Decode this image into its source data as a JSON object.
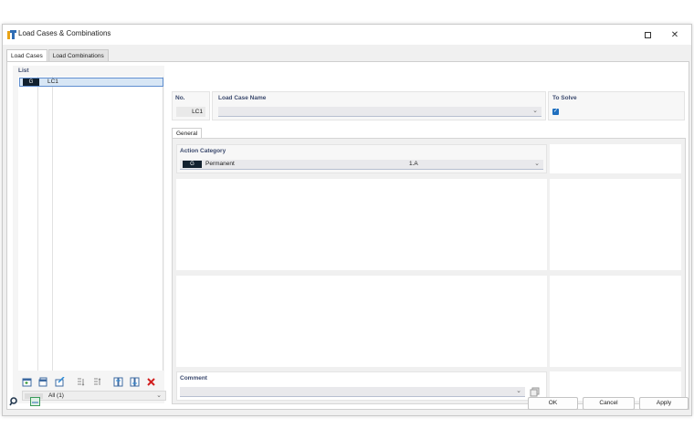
{
  "window": {
    "title": "Load Cases & Combinations"
  },
  "tabs": [
    {
      "label": "Load Cases",
      "active": true
    },
    {
      "label": "Load Combinations",
      "active": false
    }
  ],
  "list": {
    "label": "List",
    "items": [
      {
        "badge": "G",
        "label": "LC1",
        "selected": true
      }
    ],
    "filter": {
      "value": "All (1)"
    }
  },
  "fields": {
    "no_label": "No.",
    "no_value": "LC1",
    "name_label": "Load Case Name",
    "name_value": "",
    "to_solve_label": "To Solve",
    "to_solve_checked": true
  },
  "general_tab": {
    "label": "General"
  },
  "action_category": {
    "label": "Action Category",
    "badge": "G",
    "value": "Permanent",
    "code": "1.A"
  },
  "comment": {
    "label": "Comment",
    "value": ""
  },
  "footer": {
    "ok": "OK",
    "cancel": "Cancel",
    "apply": "Apply"
  },
  "colors": {
    "badge_bg": "#12212f",
    "label_color": "#3c4a6e",
    "selection": "#d7e6f5",
    "checkbox": "#1f6fbf"
  },
  "icons": [
    "app-icon",
    "maximize-icon",
    "close-icon",
    "new-icon",
    "copy-icon",
    "edit-icon",
    "renumber-icon",
    "sort-icon",
    "delete-icon",
    "search-icon",
    "units-icon"
  ]
}
